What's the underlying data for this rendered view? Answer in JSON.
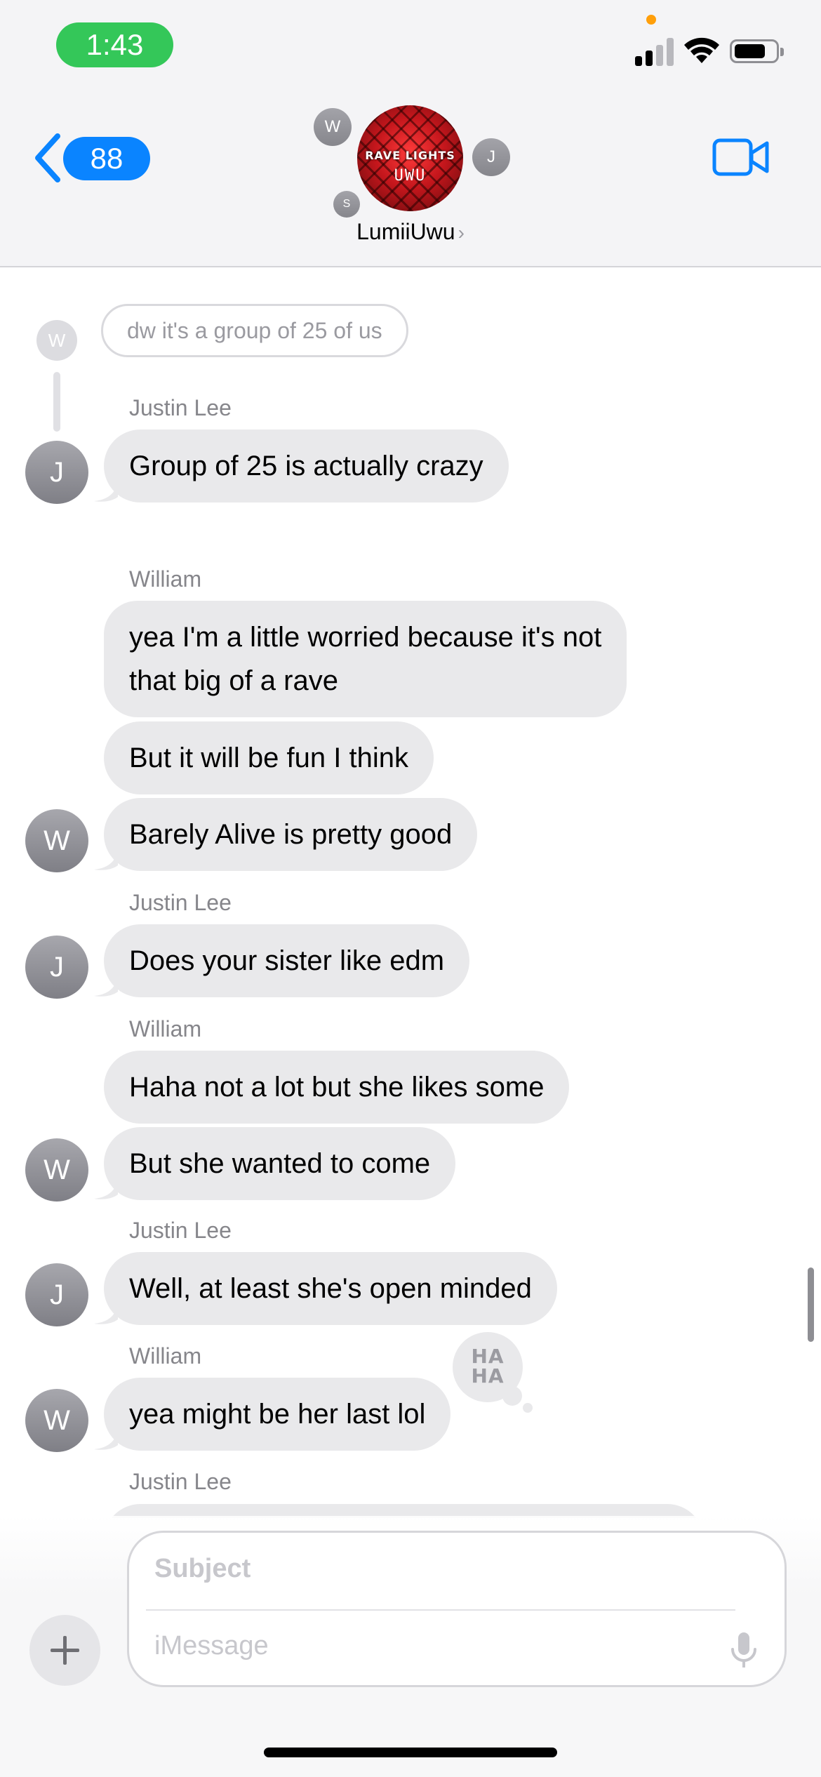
{
  "status_bar": {
    "time": "1:43"
  },
  "header": {
    "back_count": "88",
    "group_name": "LumiiUwu",
    "group_avatar_title": "RAVE LIGHTS",
    "group_avatar_sub": "UWU",
    "member_initials": {
      "top_left": "W",
      "right": "J",
      "bottom_left": "S"
    }
  },
  "thread": {
    "quoted_reply": {
      "initial": "W",
      "text": "dw it's a group of 25 of us"
    },
    "messages": [
      {
        "sender": "Justin Lee",
        "initial": "J",
        "text": "Group of 25 is actually crazy"
      },
      {
        "sender": "William",
        "initial": "W",
        "text1": "yea I'm a little worried because it's not",
        "text2": "that big of a rave"
      },
      {
        "text": "But it will be fun I think"
      },
      {
        "text": "Barely Alive is pretty good"
      },
      {
        "sender": "Justin Lee",
        "initial": "J",
        "text": "Does your sister like edm"
      },
      {
        "sender": "William",
        "initial": "W",
        "text": "Haha not a lot but she likes some"
      },
      {
        "text": "But she wanted to come"
      },
      {
        "sender": "Justin Lee",
        "initial": "J",
        "text": "Well, at least she's open minded"
      },
      {
        "sender": "William",
        "initial": "W",
        "text": "yea might be her last lol",
        "tapback_line1": "HA",
        "tapback_line2": "HA"
      },
      {
        "sender": "Justin Lee"
      }
    ]
  },
  "composer": {
    "subject_placeholder": "Subject",
    "message_placeholder": "iMessage"
  }
}
